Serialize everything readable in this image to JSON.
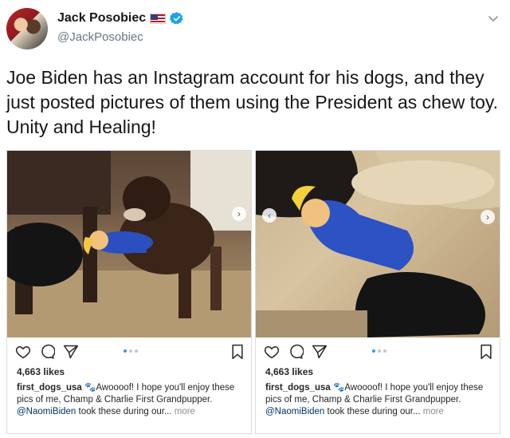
{
  "tweet": {
    "display_name": "Jack Posobiec",
    "handle": "@JackPosobiec",
    "text": "Joe Biden has an Instagram account for his dogs, and they just posted pictures of them using the President as chew toy. Unity and Healing!",
    "icons": [
      "flag-icon",
      "verified-icon",
      "chevron-down-icon"
    ]
  },
  "instagram_posts": [
    {
      "likes": "4,663 likes",
      "username": "first_dogs_usa",
      "paw": "🐾",
      "caption_1": "Awoooof! I hope you'll enjoy these pics of me, Champ & Charlie First Grandpupper.",
      "mention": "@NaomiBiden",
      "caption_2": "took these during our...",
      "more": "more"
    },
    {
      "likes": "4,663 likes",
      "username": "first_dogs_usa",
      "paw": "🐾",
      "caption_1": "Awoooof! I hope you'll enjoy these pics of me, Champ & Charlie First Grandpupper.",
      "mention": "@NaomiBiden",
      "caption_2": "took these during our...",
      "more": "more"
    }
  ],
  "colors": {
    "name": "#14171a",
    "handle": "#657786",
    "verified": "#1da1f2",
    "ig_text": "#262626",
    "ig_mention": "#003569",
    "ig_muted": "#8e8e8e",
    "ig_dot_active": "#3897f0"
  }
}
